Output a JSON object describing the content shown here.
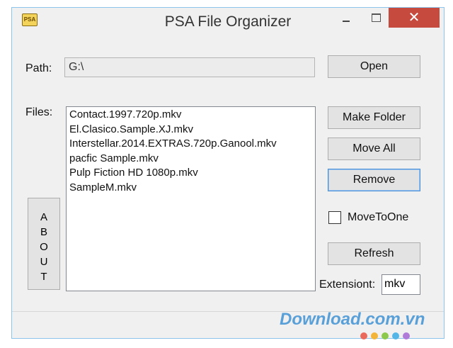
{
  "window": {
    "title": "PSA File Organizer",
    "icon_text": "PSA",
    "controls": {
      "close": "✕"
    }
  },
  "path": {
    "label": "Path:",
    "value": "G:\\"
  },
  "buttons": {
    "open": "Open",
    "make_folder": "Make Folder",
    "move_all": "Move All",
    "remove": "Remove",
    "refresh": "Refresh"
  },
  "files": {
    "label": "Files:",
    "items": [
      "Contact.1997.720p.mkv",
      "El.Clasico.Sample.XJ.mkv",
      "Interstellar.2014.EXTRAS.720p.Ganool.mkv",
      "pacfic Sample.mkv",
      "Pulp Fiction HD 1080p.mkv",
      "SampleM.mkv"
    ]
  },
  "about": {
    "letters": [
      "A",
      "B",
      "O",
      "U",
      "T"
    ]
  },
  "move_to_one": {
    "label": "MoveToOne",
    "checked": false
  },
  "extension": {
    "label": "Extensiont:",
    "value": "mkv"
  },
  "watermark": {
    "text": "Download.com.vn",
    "dot_colors": [
      "#e96a5c",
      "#f3b43a",
      "#8cc84b",
      "#54b6e6",
      "#b07bd8"
    ]
  },
  "colors": {
    "accent": "#4a90d9",
    "close_button": "#c74a3f",
    "window_border": "#8cc4ec"
  }
}
